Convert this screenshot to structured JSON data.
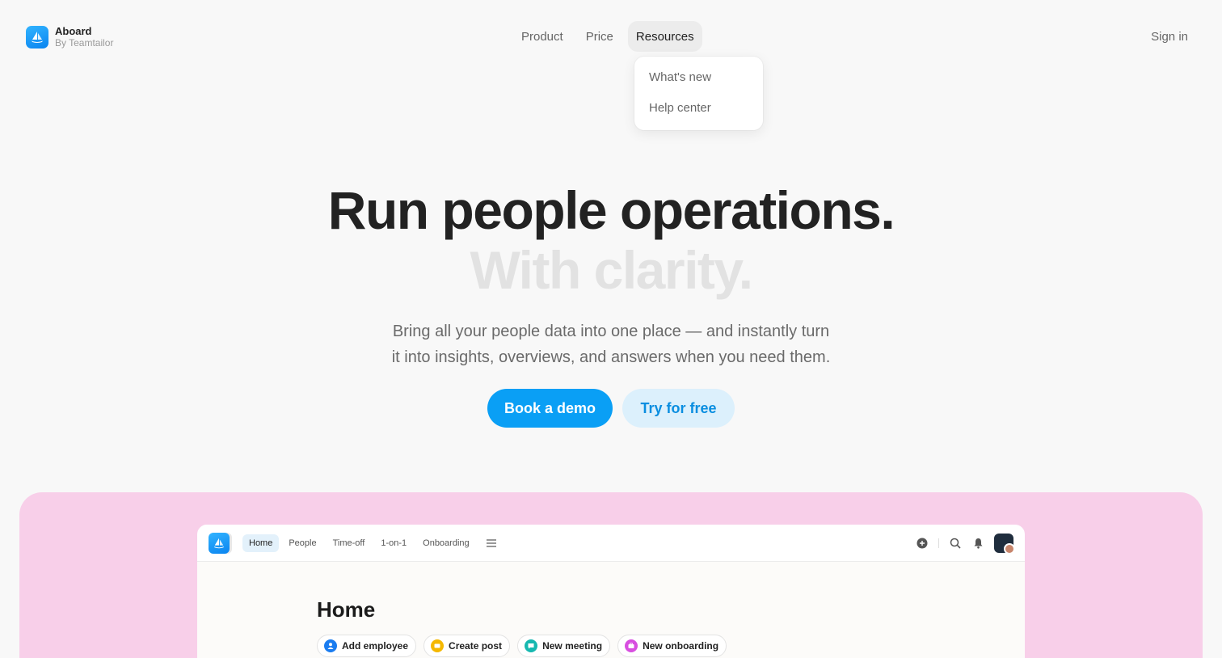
{
  "brand": {
    "name": "Aboard",
    "subtitle": "By Teamtailor"
  },
  "nav": {
    "items": [
      {
        "label": "Product"
      },
      {
        "label": "Price"
      },
      {
        "label": "Resources"
      }
    ],
    "active": "Resources",
    "sign_in": "Sign in"
  },
  "dropdown": {
    "items": [
      {
        "label": "What's new"
      },
      {
        "label": "Help center"
      }
    ]
  },
  "hero": {
    "title": "Run people operations.",
    "title_faded": "With clarity.",
    "subtitle_line1": "Bring all your people data into one place — and instantly turn",
    "subtitle_line2": "it into insights, overviews, and answers when you need them.",
    "primary_cta": "Book a demo",
    "secondary_cta": "Try for free"
  },
  "app_preview": {
    "tabs": [
      {
        "label": "Home"
      },
      {
        "label": "People"
      },
      {
        "label": "Time-off"
      },
      {
        "label": "1-on-1"
      },
      {
        "label": "Onboarding"
      }
    ],
    "active_tab": "Home",
    "page_title": "Home",
    "quick_actions": [
      {
        "label": "Add employee",
        "icon": "person-icon",
        "color": "#1a7cf0"
      },
      {
        "label": "Create post",
        "icon": "post-icon",
        "color": "#f5b800"
      },
      {
        "label": "New meeting",
        "icon": "chat-icon",
        "color": "#17b8b0"
      },
      {
        "label": "New onboarding",
        "icon": "briefcase-icon",
        "color": "#d84fe0"
      }
    ]
  },
  "colors": {
    "accent": "#0a9ff5",
    "accent_soft": "#dcf0fc",
    "showcase_bg": "#f8cfe9"
  }
}
